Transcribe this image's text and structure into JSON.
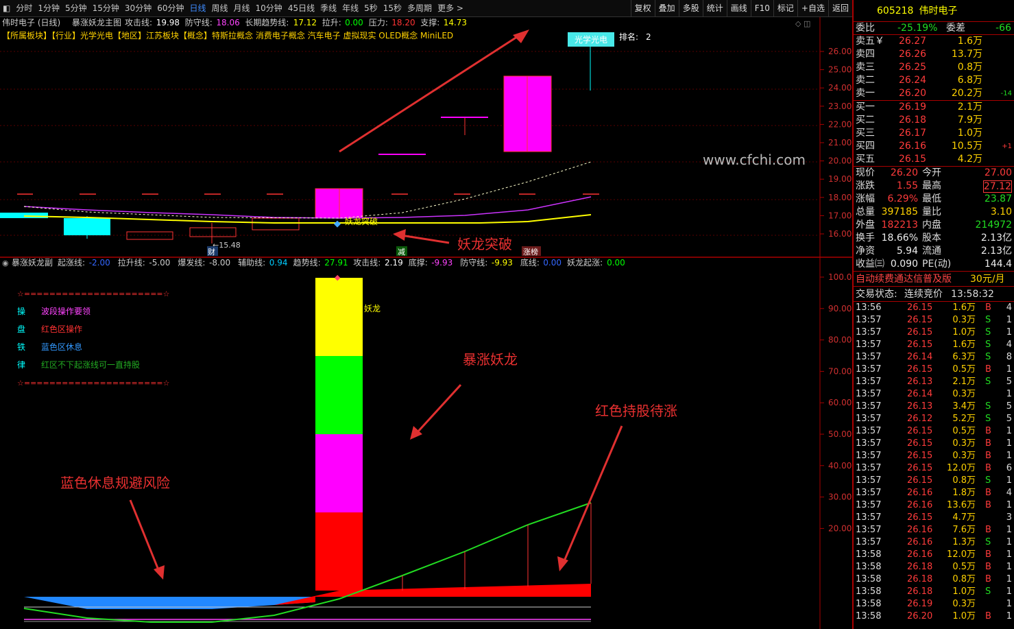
{
  "toolbar": {
    "periods": [
      "分时",
      "1分钟",
      "5分钟",
      "15分钟",
      "30分钟",
      "60分钟",
      "日线",
      "周线",
      "月线",
      "10分钟",
      "45日线",
      "季线",
      "年线",
      "5秒",
      "15秒",
      "多周期",
      "更多 >"
    ],
    "active_period": "日线",
    "actions": [
      "复权",
      "叠加",
      "多股",
      "统计",
      "画线",
      "F10",
      "标记",
      "+自选",
      "返回"
    ]
  },
  "main_chart": {
    "name_label": "伟时电子 (日线)",
    "indicator_name": "暴涨妖龙主图",
    "readouts": [
      {
        "label": "攻击线:",
        "value": "19.98",
        "color": "#ffffff"
      },
      {
        "label": "防守线:",
        "value": "18.06",
        "color": "#ff44ff"
      },
      {
        "label": "长期趋势线:",
        "value": "17.12",
        "color": "#ffff00"
      },
      {
        "label": "拉升:",
        "value": "0.00",
        "color": "#00ff00"
      },
      {
        "label": "压力:",
        "value": "18.20",
        "color": "#ff3333"
      },
      {
        "label": "支撑:",
        "value": "14.73",
        "color": "#ffff00"
      }
    ],
    "sector_line": "【所属板块】【行业】光学光电【地区】江苏板块【概念】特斯拉概念 消费电子概念 汽车电子 虚拟现实 OLED概念 MiniLED",
    "top_tag": "光学光电",
    "rank_label": "排名:",
    "rank_value": "2",
    "watermark": "www.cfchi.com",
    "y_ticks": [
      "26.00",
      "25.00",
      "24.00",
      "23.00",
      "22.00",
      "21.00",
      "20.00",
      "19.00",
      "18.00",
      "17.00",
      "16.00"
    ],
    "low_marker": "←15.48",
    "markers": [
      "财",
      "减",
      "涨榜"
    ],
    "breakout_label": "妖龙突破",
    "annotation_breakout": "妖龙突破",
    "colors": {
      "up": "#ff00ff",
      "down": "#00ffff",
      "trend": "#ffff00",
      "defense": "#cc33ff"
    }
  },
  "sub_chart": {
    "indicator_name": "暴涨妖龙副",
    "readouts": [
      {
        "label": "起涨线:",
        "value": "-2.00",
        "color": "#3366ff"
      },
      {
        "label": "拉升线:",
        "value": "-5.00",
        "color": "#cccccc"
      },
      {
        "label": "爆发线:",
        "value": "-8.00",
        "color": "#cccccc"
      },
      {
        "label": "辅助线:",
        "value": "0.94",
        "color": "#00ccff"
      },
      {
        "label": "趋势线:",
        "value": "27.91",
        "color": "#00ff00"
      },
      {
        "label": "攻击线:",
        "value": "2.19",
        "color": "#ffffff"
      },
      {
        "label": "底撑:",
        "value": "-9.93",
        "color": "#ff44ff"
      },
      {
        "label": "防守线:",
        "value": "-9.93",
        "color": "#ffff00"
      },
      {
        "label": "底线:",
        "value": "0.00",
        "color": "#3366ff"
      },
      {
        "label": "妖龙起涨:",
        "value": "0.00",
        "color": "#00ff00"
      }
    ],
    "y_ticks": [
      "100.0",
      "90.00",
      "80.00",
      "70.00",
      "60.00",
      "50.00",
      "40.00",
      "30.00",
      "20.00"
    ],
    "legend_border": "☆======================☆",
    "legend": [
      {
        "key": "操",
        "text": "波段操作要领",
        "key_color": "#00ffff",
        "text_color": "#ff44ff"
      },
      {
        "key": "盘",
        "text": "红色区操作",
        "key_color": "#00ffff",
        "text_color": "#ff3333"
      },
      {
        "key": "铁",
        "text": "蓝色区休息",
        "key_color": "#00ffff",
        "text_color": "#3399ff"
      },
      {
        "key": "律",
        "text": "红区不下起涨线可一直持股",
        "key_color": "#00ffff",
        "text_color": "#22aa22"
      }
    ],
    "bar_label": "妖龙",
    "annotation_dragon": "暴涨妖龙",
    "annotation_hold": "红色持股待涨",
    "annotation_rest": "蓝色休息规避风险"
  },
  "quote": {
    "code": "605218",
    "name": "伟时电子",
    "weibi_label": "委比",
    "weibi": "-25.19%",
    "weicha_label": "委差",
    "weicha": "-66",
    "sell": [
      {
        "label": "卖五￥",
        "price": "26.27",
        "vol": "1.6万",
        "chg": ""
      },
      {
        "label": "卖四",
        "price": "26.26",
        "vol": "13.7万",
        "chg": ""
      },
      {
        "label": "卖三",
        "price": "26.25",
        "vol": "0.8万",
        "chg": ""
      },
      {
        "label": "卖二",
        "price": "26.24",
        "vol": "6.8万",
        "chg": ""
      },
      {
        "label": "卖一",
        "price": "26.20",
        "vol": "20.2万",
        "chg": "-14"
      }
    ],
    "buy": [
      {
        "label": "买一",
        "price": "26.19",
        "vol": "2.1万",
        "chg": ""
      },
      {
        "label": "买二",
        "price": "26.18",
        "vol": "7.9万",
        "chg": ""
      },
      {
        "label": "买三",
        "price": "26.17",
        "vol": "1.0万",
        "chg": ""
      },
      {
        "label": "买四",
        "price": "26.16",
        "vol": "10.5万",
        "chg": "+1"
      },
      {
        "label": "买五",
        "price": "26.15",
        "vol": "4.2万",
        "chg": ""
      }
    ],
    "stats": [
      {
        "l1": "现价",
        "v1": "26.20",
        "c1": "#ff3b3b",
        "l2": "今开",
        "v2": "27.00",
        "c2": "#ff3b3b"
      },
      {
        "l1": "涨跌",
        "v1": "1.55",
        "c1": "#ff3b3b",
        "l2": "最高",
        "v2": "27.12",
        "c2": "#ff3b3b"
      },
      {
        "l1": "涨幅",
        "v1": "6.29%",
        "c1": "#ff3b3b",
        "l2": "最低",
        "v2": "23.87",
        "c2": "#22dd22"
      },
      {
        "l1": "总量",
        "v1": "397185",
        "c1": "#ffd200",
        "l2": "量比",
        "v2": "3.10",
        "c2": "#ffd200"
      },
      {
        "l1": "外盘",
        "v1": "182213",
        "c1": "#ff3b3b",
        "l2": "内盘",
        "v2": "214972",
        "c2": "#22dd22"
      },
      {
        "l1": "换手",
        "v1": "18.66%",
        "c1": "#eeeeee",
        "l2": "股本",
        "v2": "2.13亿",
        "c2": "#eeeeee"
      },
      {
        "l1": "净资",
        "v1": "5.94",
        "c1": "#eeeeee",
        "l2": "流通",
        "v2": "2.13亿",
        "c2": "#eeeeee"
      },
      {
        "l1": "收益㈢",
        "v1": "0.090",
        "c1": "#eeeeee",
        "l2": "PE(动)",
        "v2": "144.4",
        "c2": "#eeeeee"
      }
    ],
    "promo": "自动续费通达信普及版",
    "promo_price": "30元/月",
    "status_label": "交易状态:",
    "status": "连续竞价",
    "status_time": "13:58:32",
    "ticks": [
      {
        "t": "13:56",
        "p": "26.15",
        "v": "1.6万",
        "s": "B",
        "n": "4"
      },
      {
        "t": "13:57",
        "p": "26.15",
        "v": "0.3万",
        "s": "S",
        "n": "1"
      },
      {
        "t": "13:57",
        "p": "26.15",
        "v": "1.0万",
        "s": "S",
        "n": "1"
      },
      {
        "t": "13:57",
        "p": "26.15",
        "v": "1.6万",
        "s": "S",
        "n": "4"
      },
      {
        "t": "13:57",
        "p": "26.14",
        "v": "6.3万",
        "s": "S",
        "n": "8"
      },
      {
        "t": "13:57",
        "p": "26.15",
        "v": "0.5万",
        "s": "B",
        "n": "1"
      },
      {
        "t": "13:57",
        "p": "26.13",
        "v": "2.1万",
        "s": "S",
        "n": "5"
      },
      {
        "t": "13:57",
        "p": "26.14",
        "v": "0.3万",
        "s": "",
        "n": "1"
      },
      {
        "t": "13:57",
        "p": "26.13",
        "v": "3.4万",
        "s": "S",
        "n": "5"
      },
      {
        "t": "13:57",
        "p": "26.12",
        "v": "5.2万",
        "s": "S",
        "n": "5"
      },
      {
        "t": "13:57",
        "p": "26.15",
        "v": "0.5万",
        "s": "B",
        "n": "1"
      },
      {
        "t": "13:57",
        "p": "26.15",
        "v": "0.3万",
        "s": "B",
        "n": "1"
      },
      {
        "t": "13:57",
        "p": "26.15",
        "v": "0.3万",
        "s": "B",
        "n": "1"
      },
      {
        "t": "13:57",
        "p": "26.15",
        "v": "12.0万",
        "s": "B",
        "n": "6"
      },
      {
        "t": "13:57",
        "p": "26.15",
        "v": "0.8万",
        "s": "S",
        "n": "1"
      },
      {
        "t": "13:57",
        "p": "26.16",
        "v": "1.8万",
        "s": "B",
        "n": "4"
      },
      {
        "t": "13:57",
        "p": "26.16",
        "v": "13.6万",
        "s": "B",
        "n": "1"
      },
      {
        "t": "13:57",
        "p": "26.15",
        "v": "4.7万",
        "s": "",
        "n": "3"
      },
      {
        "t": "13:57",
        "p": "26.16",
        "v": "7.6万",
        "s": "B",
        "n": "1"
      },
      {
        "t": "13:57",
        "p": "26.16",
        "v": "1.3万",
        "s": "S",
        "n": "1"
      },
      {
        "t": "13:58",
        "p": "26.16",
        "v": "12.0万",
        "s": "B",
        "n": "1"
      },
      {
        "t": "13:58",
        "p": "26.18",
        "v": "0.5万",
        "s": "B",
        "n": "1"
      },
      {
        "t": "13:58",
        "p": "26.18",
        "v": "0.8万",
        "s": "B",
        "n": "1"
      },
      {
        "t": "13:58",
        "p": "26.18",
        "v": "1.0万",
        "s": "S",
        "n": "1"
      },
      {
        "t": "13:58",
        "p": "26.19",
        "v": "0.3万",
        "s": "",
        "n": "1"
      },
      {
        "t": "13:58",
        "p": "26.20",
        "v": "1.0万",
        "s": "B",
        "n": "1"
      }
    ]
  }
}
